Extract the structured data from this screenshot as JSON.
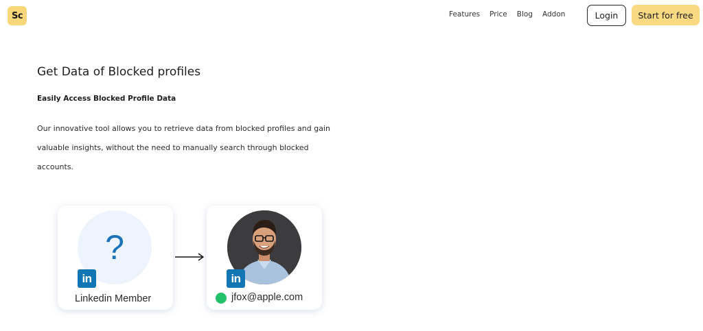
{
  "header": {
    "logo_text": "Sc",
    "nav": [
      "Features",
      "Price",
      "Blog",
      "Addon"
    ],
    "login_label": "Login",
    "start_label": "Start for free"
  },
  "main": {
    "title": "Get Data of Blocked profiles",
    "subtitle": "Easily Access Blocked Profile Data",
    "description": "Our innovative tool allows you to retrieve data from blocked profiles and gain valuable insights, without the need to manually search through blocked accounts."
  },
  "illustration": {
    "left_card": {
      "symbol": "?",
      "badge": "in",
      "label": "Linkedin Member"
    },
    "right_card": {
      "badge": "in",
      "email": "jfox@apple.com"
    }
  },
  "colors": {
    "accent_yellow": "#fad983",
    "linkedin_blue": "#1276b5",
    "status_green": "#22c26b"
  }
}
